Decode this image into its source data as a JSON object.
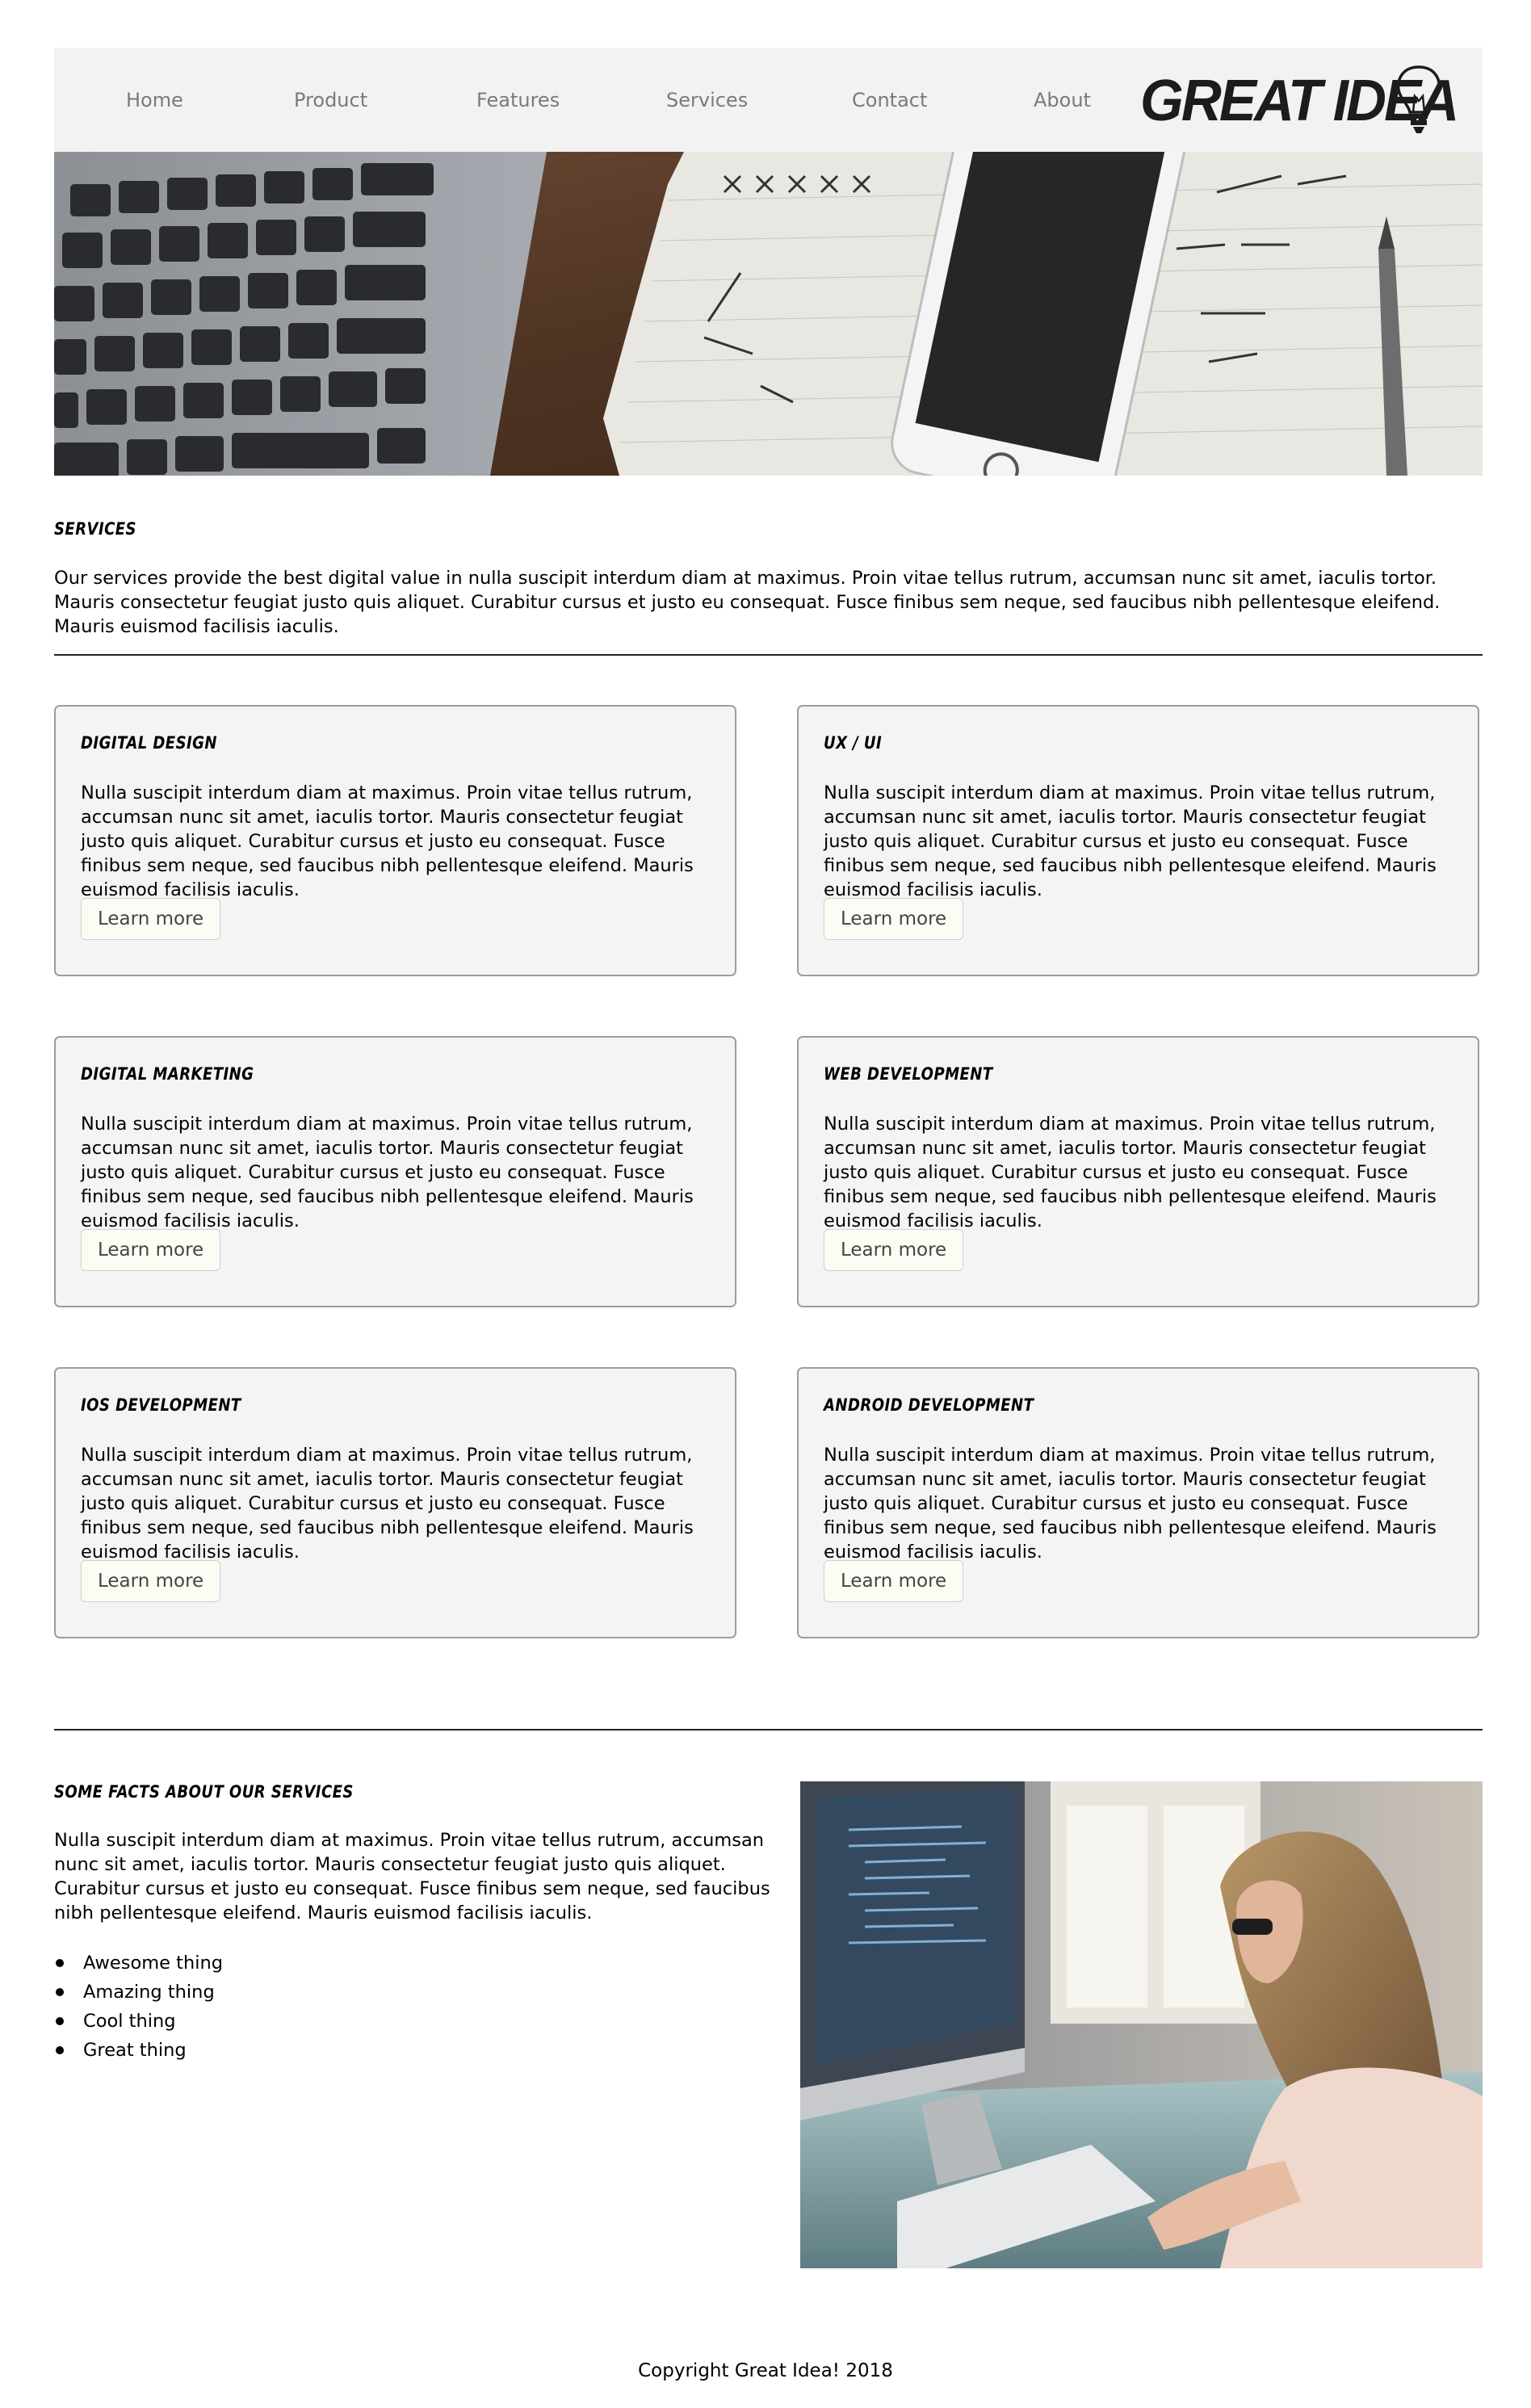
{
  "nav": {
    "links": [
      "Home",
      "Product",
      "Features",
      "Services",
      "Contact",
      "About"
    ],
    "logo_text": "GREAT IDEA"
  },
  "hero": {
    "image": "laptop-phone-notebook-photo"
  },
  "intro": {
    "heading": "SERVICES",
    "text": "Our services provide the best digital value in nulla suscipit interdum diam at maximus. Proin vitae tellus rutrum, accumsan nunc sit amet, iaculis tortor. Mauris consectetur feugiat justo quis aliquet. Curabitur cursus et justo eu consequat. Fusce finibus sem neque, sed faucibus nibh pellentesque eleifend. Mauris euismod facilisis iaculis."
  },
  "cards": [
    {
      "title": "DIGITAL DESIGN",
      "text": "Nulla suscipit interdum diam at maximus. Proin vitae tellus rutrum, accumsan nunc sit amet, iaculis tortor. Mauris consectetur feugiat justo quis aliquet. Curabitur cursus et justo eu consequat. Fusce finibus sem neque, sed faucibus nibh pellentesque eleifend. Mauris euismod facilisis iaculis.",
      "button": "Learn more"
    },
    {
      "title": "UX / UI",
      "text": "Nulla suscipit interdum diam at maximus. Proin vitae tellus rutrum, accumsan nunc sit amet, iaculis tortor. Mauris consectetur feugiat justo quis aliquet. Curabitur cursus et justo eu consequat. Fusce finibus sem neque, sed faucibus nibh pellentesque eleifend. Mauris euismod facilisis iaculis.",
      "button": "Learn more"
    },
    {
      "title": "DIGITAL MARKETING",
      "text": "Nulla suscipit interdum diam at maximus. Proin vitae tellus rutrum, accumsan nunc sit amet, iaculis tortor. Mauris consectetur feugiat justo quis aliquet. Curabitur cursus et justo eu consequat. Fusce finibus sem neque, sed faucibus nibh pellentesque eleifend. Mauris euismod facilisis iaculis.",
      "button": "Learn more"
    },
    {
      "title": "WEB DEVELOPMENT",
      "text": "Nulla suscipit interdum diam at maximus. Proin vitae tellus rutrum, accumsan nunc sit amet, iaculis tortor. Mauris consectetur feugiat justo quis aliquet. Curabitur cursus et justo eu consequat. Fusce finibus sem neque, sed faucibus nibh pellentesque eleifend. Mauris euismod facilisis iaculis.",
      "button": "Learn more"
    },
    {
      "title": "IOS DEVELOPMENT",
      "text": "Nulla suscipit interdum diam at maximus. Proin vitae tellus rutrum, accumsan nunc sit amet, iaculis tortor. Mauris consectetur feugiat justo quis aliquet. Curabitur cursus et justo eu consequat. Fusce finibus sem neque, sed faucibus nibh pellentesque eleifend. Mauris euismod facilisis iaculis.",
      "button": "Learn more"
    },
    {
      "title": "ANDROID DEVELOPMENT",
      "text": "Nulla suscipit interdum diam at maximus. Proin vitae tellus rutrum, accumsan nunc sit amet, iaculis tortor. Mauris consectetur feugiat justo quis aliquet. Curabitur cursus et justo eu consequat. Fusce finibus sem neque, sed faucibus nibh pellentesque eleifend. Mauris euismod facilisis iaculis.",
      "button": "Learn more"
    }
  ],
  "facts": {
    "heading": "SOME FACTS ABOUT OUR SERVICES",
    "text": "Nulla suscipit interdum diam at maximus. Proin vitae tellus rutrum, accumsan nunc sit amet, iaculis tortor. Mauris consectetur feugiat justo quis aliquet. Curabitur cursus et justo eu consequat. Fusce finibus sem neque, sed faucibus nibh pellentesque eleifend. Mauris euismod facilisis iaculis.",
    "items": [
      "Awesome thing",
      "Amazing thing",
      "Cool thing",
      "Great thing"
    ],
    "image": "woman-at-computer-photo"
  },
  "footer": {
    "copyright": "Copyright Great Idea! 2018"
  },
  "colors": {
    "nav_bg": "#f2f2f2",
    "card_bg": "#f4f4f4",
    "button_bg": "#fcfcf4",
    "text": "#000000"
  }
}
